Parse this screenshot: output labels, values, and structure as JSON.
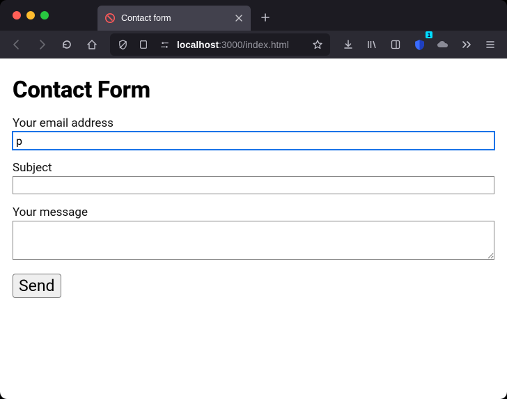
{
  "browser": {
    "tab_title": "Contact form",
    "url_host": "localhost",
    "url_port": ":3000",
    "url_path": "/index.html",
    "toolbar_badge": "1"
  },
  "page": {
    "heading": "Contact Form",
    "email_label": "Your email address",
    "email_value": "p",
    "subject_label": "Subject",
    "subject_value": "",
    "message_label": "Your message",
    "message_value": "",
    "send_label": "Send"
  }
}
